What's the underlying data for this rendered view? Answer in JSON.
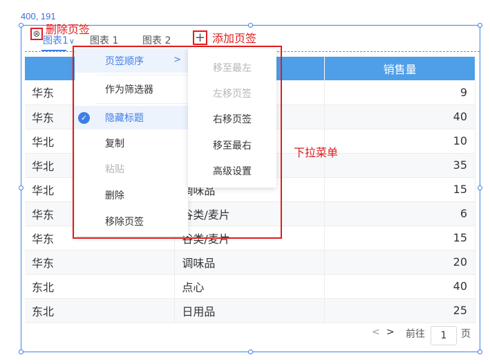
{
  "coords": "400, 191",
  "tabs": [
    {
      "label": "图表1"
    },
    {
      "label": "图表 1"
    },
    {
      "label": "图表 2"
    }
  ],
  "annotations": {
    "delete_tab": "删除页签",
    "add_tab": "添加页签",
    "dropdown": "下拉菜单"
  },
  "icons": {
    "close_tab": "⊗",
    "add_tab": "+",
    "chevron": ">",
    "check": "✓",
    "tab_dropdown": "∨",
    "prev": "<",
    "next": ">"
  },
  "table": {
    "headers": [
      "",
      "",
      "销售量"
    ],
    "rows": [
      [
        "华东",
        "",
        "9"
      ],
      [
        "华东",
        "",
        "40"
      ],
      [
        "华北",
        "",
        "10"
      ],
      [
        "华北",
        "",
        "35"
      ],
      [
        "华北",
        "调味品",
        "15"
      ],
      [
        "华东",
        "谷类/麦片",
        "6"
      ],
      [
        "华东",
        "谷类/麦片",
        "15"
      ],
      [
        "华东",
        "调味品",
        "20"
      ],
      [
        "东北",
        "点心",
        "40"
      ],
      [
        "东北",
        "日用品",
        "25"
      ]
    ]
  },
  "menu": {
    "items": [
      {
        "label": "页签顺序",
        "state": "highlight"
      },
      {
        "label": "作为筛选器",
        "state": "normal"
      },
      {
        "label": "隐藏标题",
        "state": "selected"
      },
      {
        "label": "复制",
        "state": "normal"
      },
      {
        "label": "粘贴",
        "state": "disabled"
      },
      {
        "label": "删除",
        "state": "normal"
      },
      {
        "label": "移除页签",
        "state": "normal"
      }
    ]
  },
  "submenu": {
    "items": [
      {
        "label": "移至最左",
        "state": "disabled"
      },
      {
        "label": "左移页签",
        "state": "disabled"
      },
      {
        "label": "右移页签",
        "state": "normal"
      },
      {
        "label": "移至最右",
        "state": "normal"
      },
      {
        "label": "高级设置",
        "state": "normal"
      }
    ]
  },
  "pager": {
    "goto_label": "前往",
    "page_value": "1",
    "page_suffix": "页"
  },
  "colors": {
    "accent": "#3f7ee6",
    "header_bg": "#4f9ee8",
    "annotation_red": "#e21b1b"
  }
}
